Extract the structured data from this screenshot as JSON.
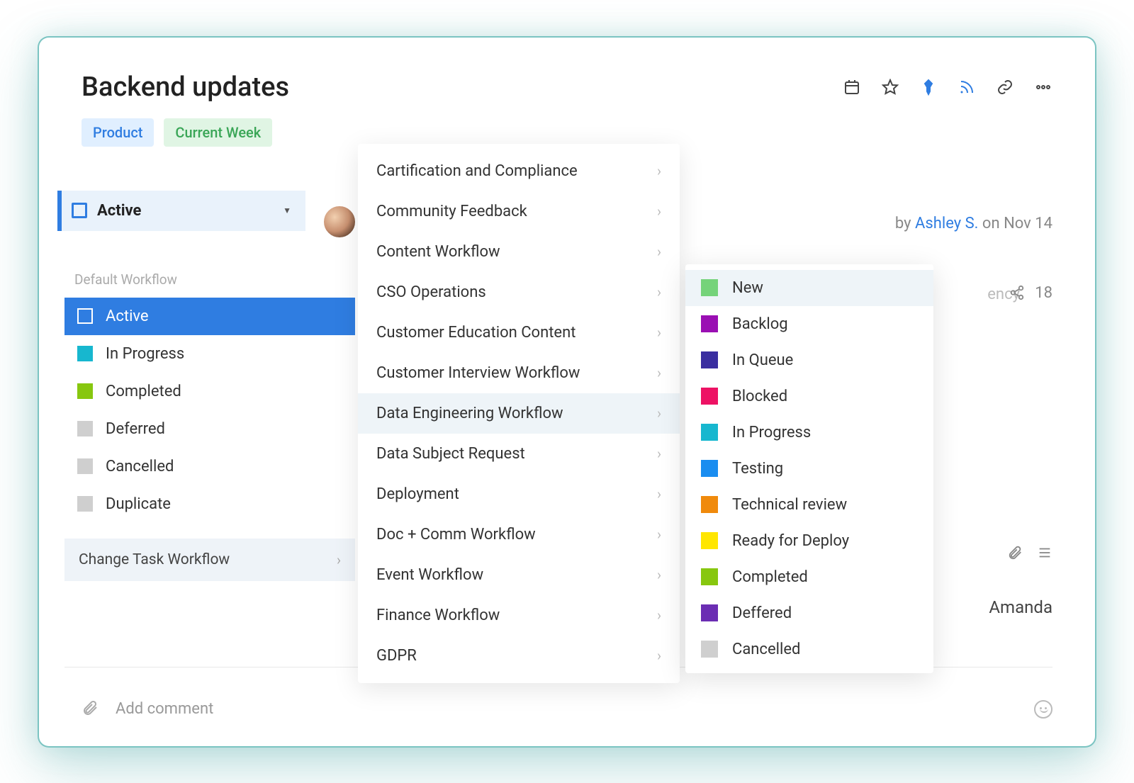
{
  "header": {
    "title": "Backend updates",
    "tags": [
      {
        "label": "Product",
        "class": "product"
      },
      {
        "label": "Current Week",
        "class": "weekly"
      }
    ]
  },
  "byline": {
    "prefix": "by ",
    "author": "Ashley S.",
    "suffix": " on Nov 14"
  },
  "partial_word": "ency",
  "share_count": "18",
  "assignee_right": "Amanda",
  "status_dropdown": {
    "label": "Active"
  },
  "left_panel": {
    "group_title": "Default Workflow",
    "items": [
      {
        "label": "Active",
        "color": "#2f7de1",
        "selected": true
      },
      {
        "label": "In Progress",
        "color": "#17b7cf",
        "selected": false
      },
      {
        "label": "Completed",
        "color": "#87c70f",
        "selected": false
      },
      {
        "label": "Deferred",
        "color": "#cfcfcf",
        "selected": false
      },
      {
        "label": "Cancelled",
        "color": "#cfcfcf",
        "selected": false
      },
      {
        "label": "Duplicate",
        "color": "#cfcfcf",
        "selected": false
      }
    ],
    "change_workflow": "Change Task Workflow"
  },
  "workflow_menu": {
    "items": [
      {
        "label": "Cartification and Compliance",
        "hovered": false
      },
      {
        "label": "Community Feedback",
        "hovered": false
      },
      {
        "label": "Content Workflow",
        "hovered": false
      },
      {
        "label": "CSO Operations",
        "hovered": false
      },
      {
        "label": "Customer Education Content",
        "hovered": false
      },
      {
        "label": "Customer Interview Workflow",
        "hovered": false
      },
      {
        "label": "Data Engineering Workflow",
        "hovered": true
      },
      {
        "label": "Data Subject Request",
        "hovered": false
      },
      {
        "label": "Deployment",
        "hovered": false
      },
      {
        "label": "Doc + Comm Workflow",
        "hovered": false
      },
      {
        "label": "Event Workflow",
        "hovered": false
      },
      {
        "label": "Finance Workflow",
        "hovered": false
      },
      {
        "label": "GDPR",
        "hovered": false
      }
    ]
  },
  "sub_menu": {
    "items": [
      {
        "label": "New",
        "color": "#75d37a",
        "hovered": true
      },
      {
        "label": "Backlog",
        "color": "#9a0fb3",
        "hovered": false
      },
      {
        "label": "In Queue",
        "color": "#3a2ea0",
        "hovered": false
      },
      {
        "label": "Blocked",
        "color": "#ed1264",
        "hovered": false
      },
      {
        "label": "In Progress",
        "color": "#17b7cf",
        "hovered": false
      },
      {
        "label": "Testing",
        "color": "#1a8df0",
        "hovered": false
      },
      {
        "label": "Technical review",
        "color": "#f08a0c",
        "hovered": false
      },
      {
        "label": "Ready for Deploy",
        "color": "#ffe600",
        "hovered": false
      },
      {
        "label": "Completed",
        "color": "#87c70f",
        "hovered": false
      },
      {
        "label": "Deffered",
        "color": "#6b2db3",
        "hovered": false
      },
      {
        "label": "Cancelled",
        "color": "#cfcfcf",
        "hovered": false
      }
    ]
  },
  "comment": {
    "placeholder": "Add comment"
  }
}
